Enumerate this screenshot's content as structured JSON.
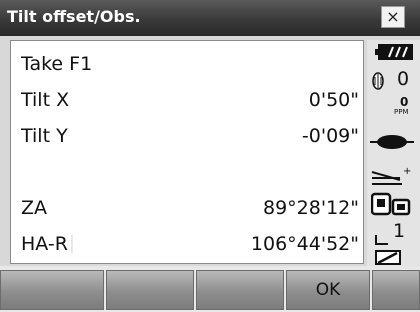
{
  "window": {
    "title": "Tilt offset/Obs.",
    "close_label": "×"
  },
  "fields": [
    {
      "label": "Take F1",
      "value": ""
    },
    {
      "label": "Tilt X",
      "value": "0'50\""
    },
    {
      "label": "Tilt Y",
      "value": "-0'09\""
    },
    {
      "label": "ZA",
      "value": "89°28'12\""
    },
    {
      "label": "HA-R",
      "value": "106°44'52\""
    }
  ],
  "status": {
    "prism_constant": "0",
    "ppm": "0",
    "ppm_unit": "PPM",
    "page_number": "1"
  },
  "softkeys": [
    "",
    "",
    "",
    "OK",
    ""
  ],
  "colors": {
    "title_bar": "#3a3a3a",
    "panel": "#ffffff",
    "key": "#9a9a9a"
  }
}
